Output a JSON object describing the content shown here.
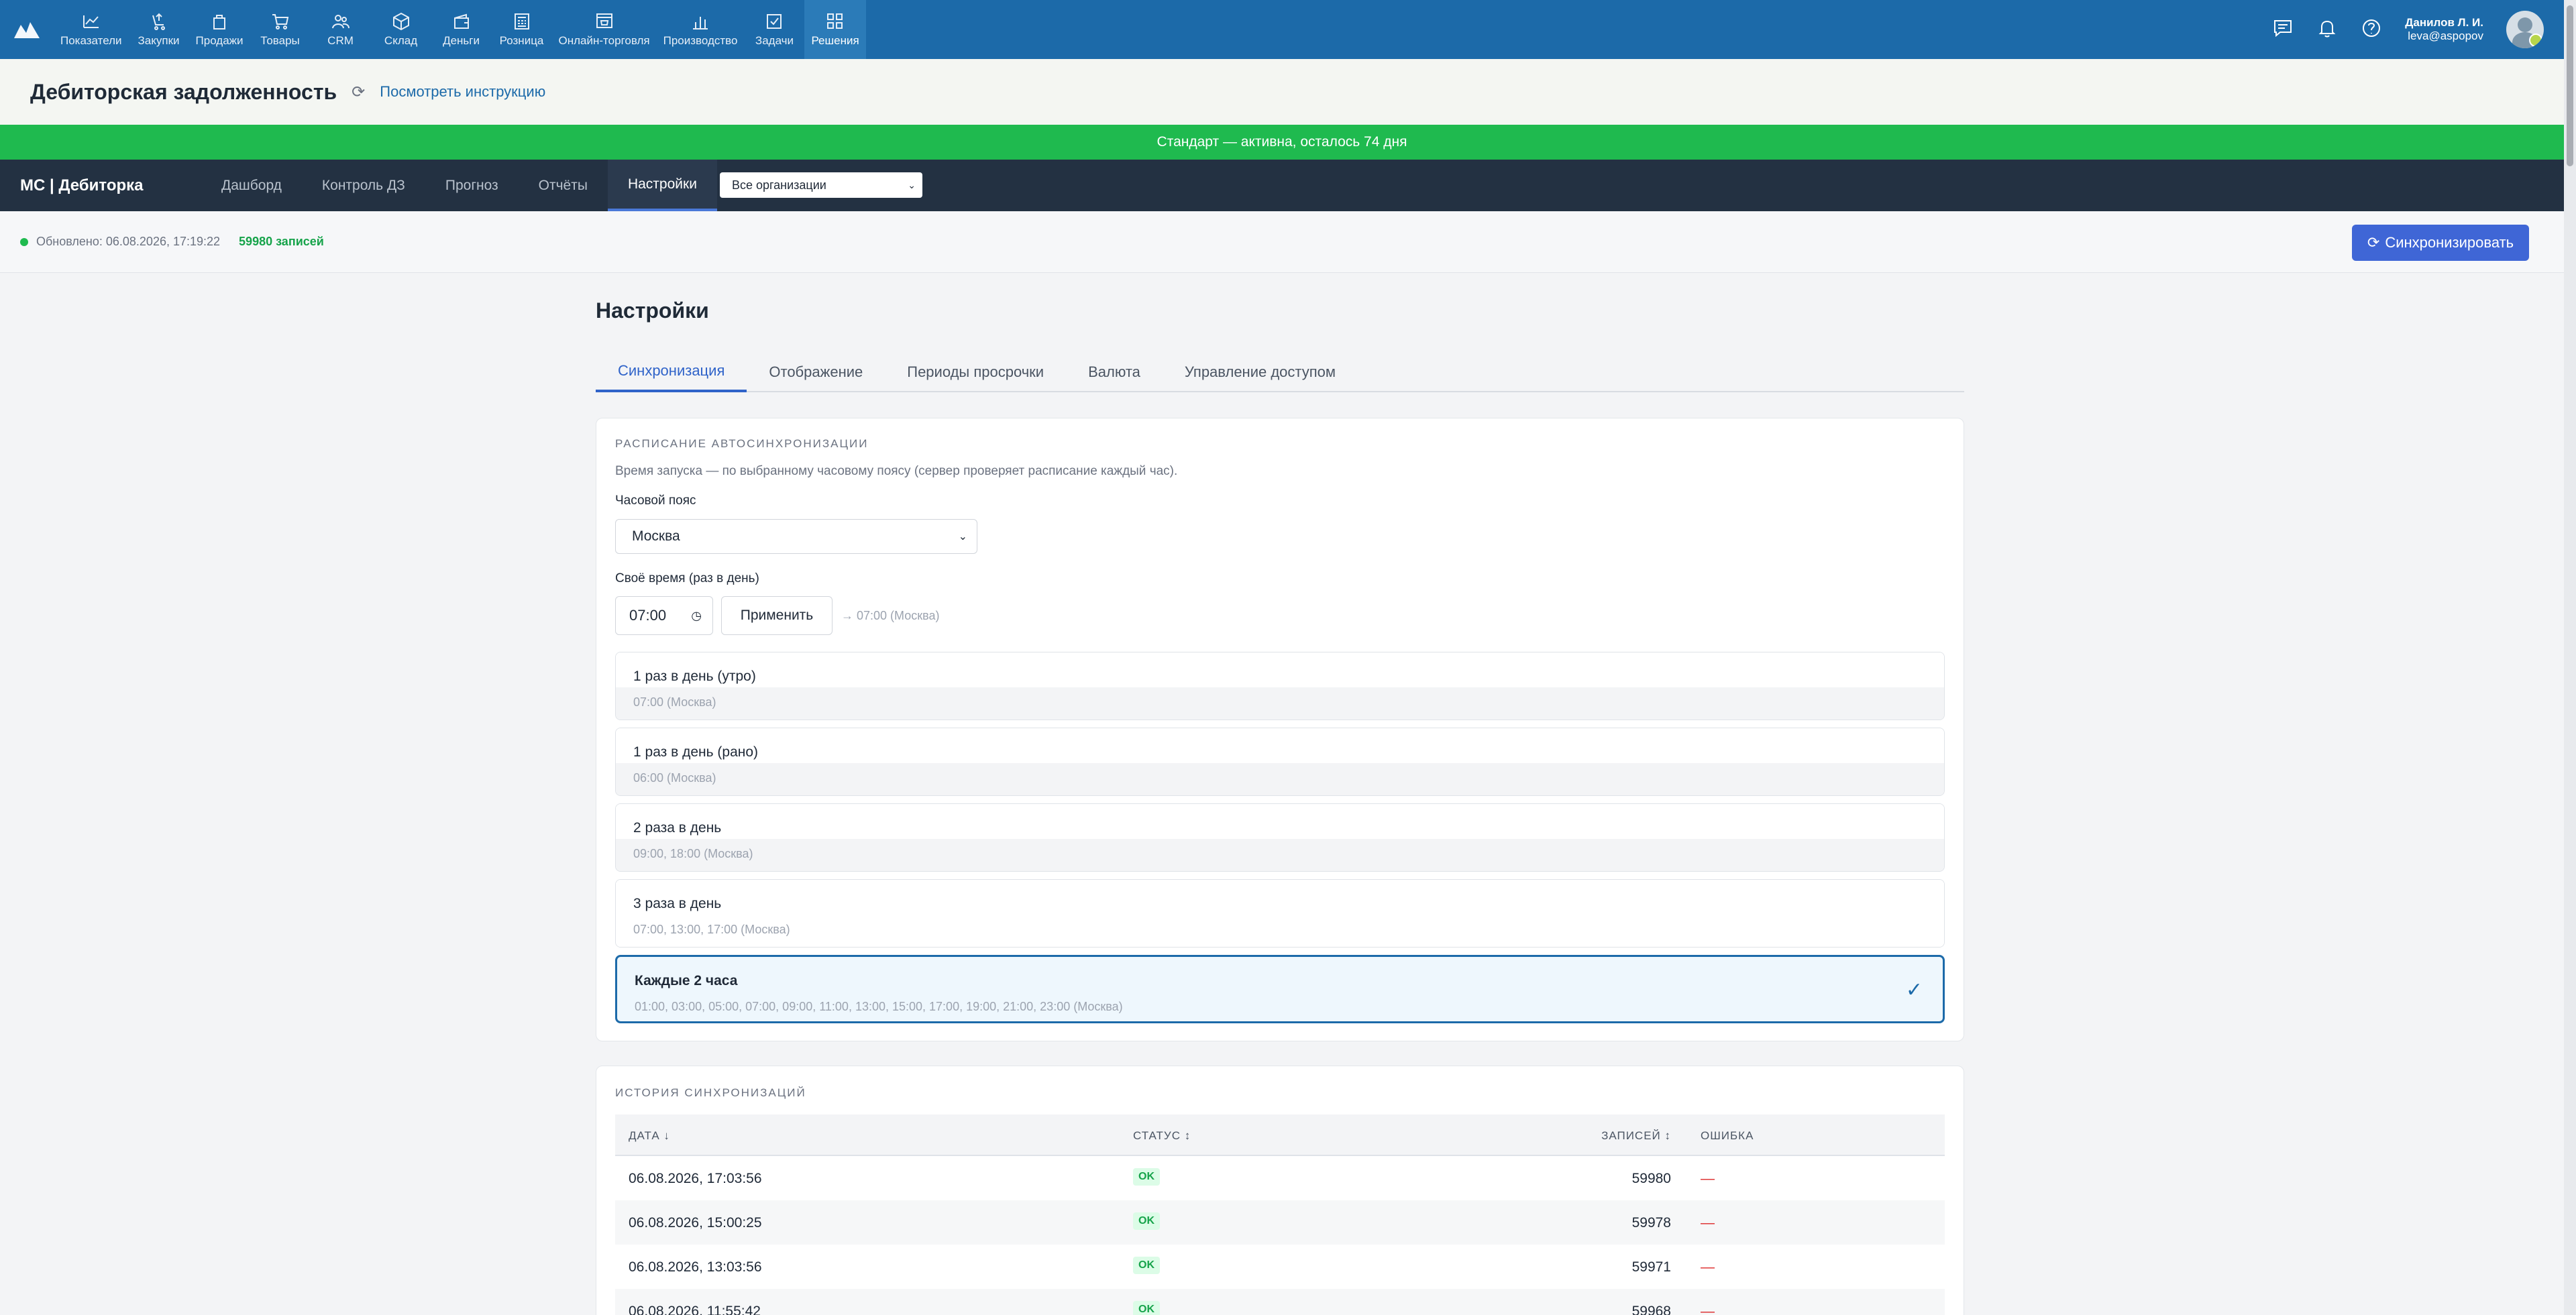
{
  "topnav": {
    "items": [
      {
        "label": "Показатели",
        "icon": "chart-line-icon"
      },
      {
        "label": "Закупки",
        "icon": "cart-up-icon"
      },
      {
        "label": "Продажи",
        "icon": "bag-icon"
      },
      {
        "label": "Товары",
        "icon": "cart-icon"
      },
      {
        "label": "CRM",
        "icon": "people-icon"
      },
      {
        "label": "Склад",
        "icon": "box-icon"
      },
      {
        "label": "Деньги",
        "icon": "wallet-icon"
      },
      {
        "label": "Розница",
        "icon": "register-icon"
      },
      {
        "label": "Онлайн-торговля",
        "icon": "web-store-icon"
      },
      {
        "label": "Производство",
        "icon": "bars-icon"
      },
      {
        "label": "Задачи",
        "icon": "checkbox-icon"
      },
      {
        "label": "Решения",
        "icon": "grid-icon"
      }
    ],
    "user_name": "Данилов Л. И.",
    "user_email": "leva@aspopov"
  },
  "page": {
    "title": "Дебиторская задолженность",
    "instruction_link": "Посмотреть инструкцию"
  },
  "banner": "Стандарт — активна, осталось 74 дня",
  "appnav": {
    "app_name": "МС | Дебиторка",
    "items": [
      "Дашборд",
      "Контроль ДЗ",
      "Прогноз",
      "Отчёты",
      "Настройки"
    ],
    "org_select": "Все организации"
  },
  "status": {
    "updated": "Обновлено: 06.08.2026, 17:19:22",
    "records": "59980 записей",
    "sync_button": "Синхронизировать"
  },
  "settings": {
    "title": "Настройки",
    "tabs": [
      "Синхронизация",
      "Отображение",
      "Периоды просрочки",
      "Валюта",
      "Управление доступом"
    ],
    "schedule_caption": "РАСПИСАНИЕ АВТОСИНХРОНИЗАЦИИ",
    "schedule_hint": "Время запуска — по выбранному часовому поясу (сервер проверяет расписание каждый час).",
    "tz_label": "Часовой пояс",
    "tz_value": "Москва",
    "custom_label": "Своё время (раз в день)",
    "time_value": "07:00",
    "apply_button": "Применить",
    "preview": "→ 07:00 (Москва)",
    "options": [
      {
        "title": "1 раз в день (утро)",
        "times": "07:00 (Москва)"
      },
      {
        "title": "1 раз в день (рано)",
        "times": "06:00 (Москва)"
      },
      {
        "title": "2 раза в день",
        "times": "09:00, 18:00 (Москва)"
      },
      {
        "title": "3 раза в день",
        "times": "07:00, 13:00, 17:00 (Москва)"
      },
      {
        "title": "Каждые 2 часа",
        "times": "01:00, 03:00, 05:00, 07:00, 09:00, 11:00, 13:00, 15:00, 17:00, 19:00, 21:00, 23:00 (Москва)"
      }
    ],
    "selected_option": 4
  },
  "history": {
    "caption": "ИСТОРИЯ СИНХРОНИЗАЦИЙ",
    "headers": {
      "date": "ДАТА ↓",
      "status": "СТАТУС ↕",
      "records": "ЗАПИСЕЙ ↕",
      "error": "ОШИБКА"
    },
    "rows": [
      {
        "date": "06.08.2026, 17:03:56",
        "status": "OK",
        "records": "59980",
        "error": "—"
      },
      {
        "date": "06.08.2026, 15:00:25",
        "status": "OK",
        "records": "59978",
        "error": "—"
      },
      {
        "date": "06.08.2026, 13:03:56",
        "status": "OK",
        "records": "59971",
        "error": "—"
      },
      {
        "date": "06.08.2026, 11:55:42",
        "status": "OK",
        "records": "59968",
        "error": "—"
      }
    ]
  }
}
